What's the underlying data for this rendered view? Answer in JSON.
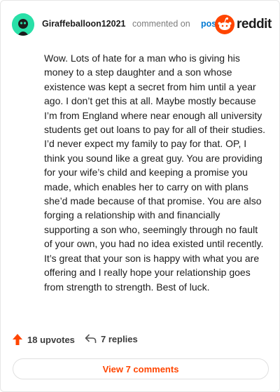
{
  "header": {
    "username": "Giraffeballoon12021",
    "action_text": "commented on",
    "post_link": "post",
    "brand": "reddit"
  },
  "comment": {
    "body": "Wow. Lots of hate for a man who is giving his money to a step daughter and a son whose existence was kept a secret from him until a year ago. I don’t get this at all. Maybe mostly because I’m from England where near enough all university students get out loans to pay for all of their studies. I’d never expect my family to pay for that. OP, I think you sound like a great guy. You are providing for your wife’s child and keeping a promise you made, which enables her to carry on with plans she’d made because of that promise. You are also forging a relationship with and financially supporting a son who, seemingly through no fault of your own, you had no idea existed until recently. It’s great that your son is happy with what you are offering and I really hope your relationship goes from strength to strength. Best of luck."
  },
  "footer": {
    "upvotes": "18 upvotes",
    "replies": "7 replies",
    "view_comments": "View 7 comments"
  },
  "colors": {
    "accent": "#ff4500",
    "link": "#0079d3",
    "avatar": "#29e0a8"
  },
  "icons": {
    "upvote": "upvote-arrow-icon",
    "reply": "reply-arrow-icon",
    "brand": "reddit-snoo-icon"
  }
}
